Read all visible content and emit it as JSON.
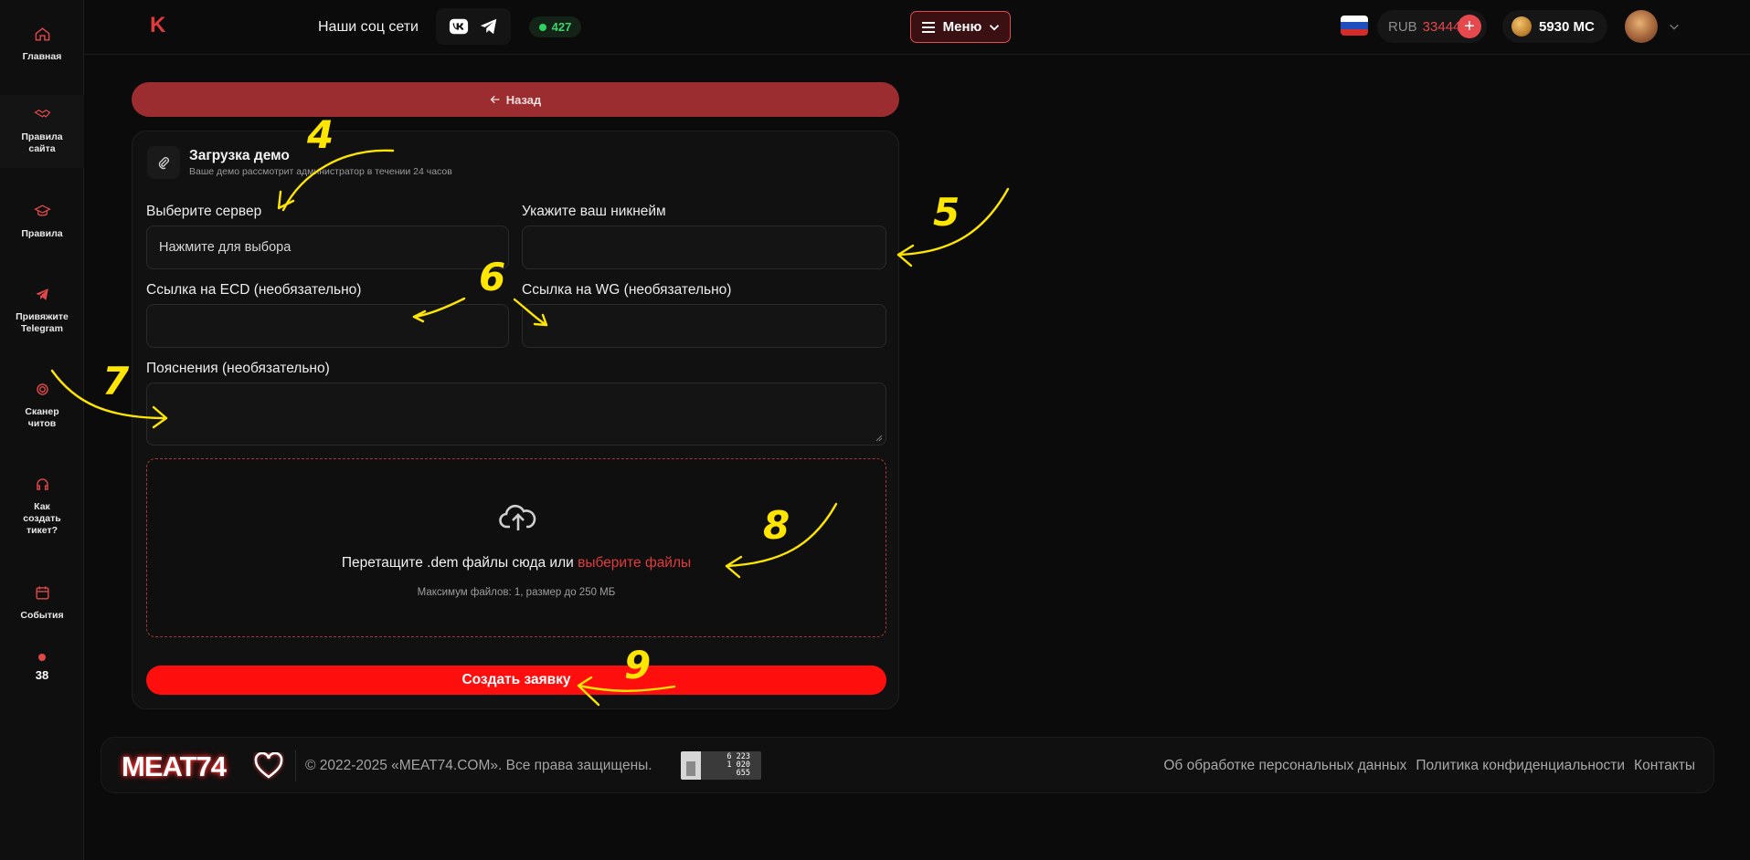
{
  "sidebar": {
    "items": [
      {
        "label": "Главная",
        "icon": "home-icon"
      },
      {
        "label": "Правила сайта",
        "icon": "handshake-icon"
      },
      {
        "label": "Правила",
        "icon": "graduation-cap-icon"
      },
      {
        "label": "Привяжите Telegram",
        "icon": "telegram-icon"
      },
      {
        "label": "Сканер читов",
        "icon": "scanner-icon"
      },
      {
        "label": "Как создать тикет?",
        "icon": "headset-icon"
      },
      {
        "label": "События",
        "icon": "calendar-icon"
      }
    ],
    "count": "38"
  },
  "header": {
    "logo": "K",
    "social_label": "Наши соц сети",
    "online": "427",
    "menu_label": "Меню",
    "currency": "RUB",
    "balance": "33444",
    "plus": "+",
    "mc": "5930 MC"
  },
  "main": {
    "back_label": "Назад",
    "card": {
      "title": "Загрузка демо",
      "subtitle": "Ваше демо рассмотрит администратор в течении 24 часов",
      "server_label": "Выберите сервер",
      "server_value": "Нажмите для выбора",
      "nickname_label": "Укажите ваш никнейм",
      "ecd_label": "Ссылка на ECD (необязательно)",
      "wg_label": "Ссылка на WG (необязательно)",
      "notes_label": "Пояснения (необязательно)",
      "drop_text": "Перетащите .dem файлы сюда или",
      "drop_link": "выберите файлы",
      "drop_hint": "Максимум файлов: 1, размер до 250 МБ",
      "submit_label": "Создать заявку"
    }
  },
  "footer": {
    "logo": "MEAT74",
    "copyright": "© 2022-2025 «MEAT74.COM». Все права защищены.",
    "counter": [
      "6 223",
      "1 020",
      "655"
    ],
    "links": [
      "Об обработке персональных данных",
      "Политика конфиденциальности",
      "Контакты"
    ]
  },
  "annotations": [
    "4",
    "5",
    "6",
    "7",
    "8",
    "9"
  ],
  "colors": {
    "accent": "#e5484d",
    "submit": "#ff0e0e",
    "back": "#9b2c30",
    "annotation": "#ffe600"
  }
}
